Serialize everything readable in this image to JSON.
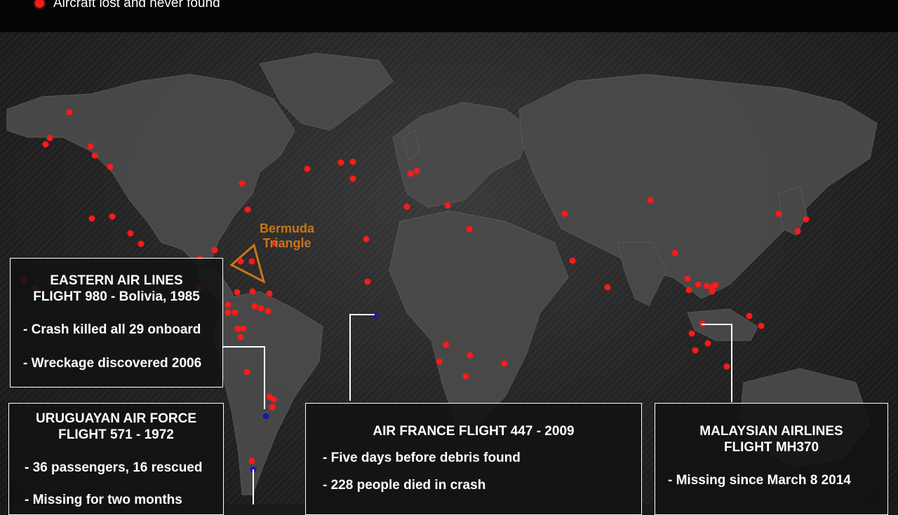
{
  "legend": {
    "label": "Aircraft lost and never found",
    "dot_color": "#ff1a1a"
  },
  "bermuda": {
    "line1": "Bermuda",
    "line2": "Triangle",
    "color": "#c8761a"
  },
  "callouts": {
    "eastern": {
      "title1": "EASTERN AIR LINES",
      "title2": "FLIGHT 980 - Bolivia, 1985",
      "bullet1": "- Crash killed all 29 onboard",
      "bullet2": "- Wreckage discovered 2006"
    },
    "uruguayan": {
      "title1": "URUGUAYAN AIR FORCE",
      "title2": "FLIGHT 571 - 1972",
      "bullet1": "- 36 passengers, 16 rescued",
      "bullet2": "- Missing for two months"
    },
    "airfrance": {
      "title1": "AIR FRANCE FLIGHT 447 - 2009",
      "bullet1": "- Five days before debris found",
      "bullet2": "- 228 people died in crash"
    },
    "malaysian": {
      "title1": "MALAYSIAN AIRLINES",
      "title2": "FLIGHT MH370",
      "bullet1": "- Missing since March 8 2014"
    }
  },
  "colors": {
    "lost_marker": "#ff1a1a",
    "found_marker": "#1a1aa8",
    "land": "#4a4a4a",
    "ocean": "#222222"
  }
}
